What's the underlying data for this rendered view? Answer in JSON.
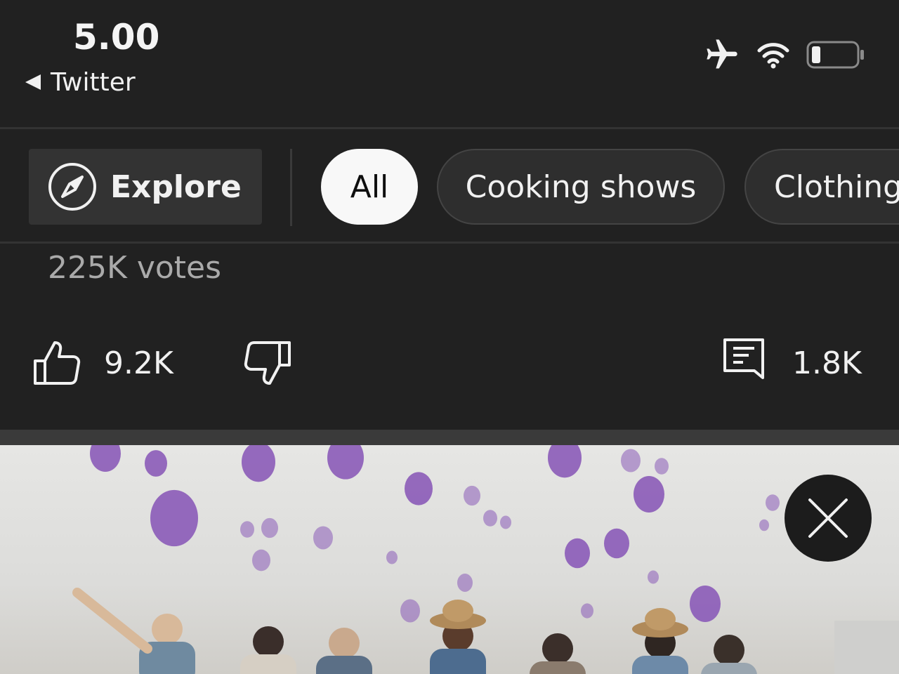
{
  "status_bar": {
    "time": "5.00",
    "back_label": "Twitter",
    "icons": [
      "airplane-mode-icon",
      "wifi-icon",
      "battery-icon"
    ]
  },
  "chips": {
    "explore_label": "Explore",
    "items": [
      {
        "label": "All",
        "selected": true
      },
      {
        "label": "Cooking shows",
        "selected": false
      },
      {
        "label": "Clothing",
        "selected": false
      }
    ]
  },
  "poll": {
    "votes": "225K votes"
  },
  "actions": {
    "likes": "9.2K",
    "comments": "1.8K"
  },
  "video": {
    "background_color": "#e2e2e0",
    "balloon_color": "#8b5bb8"
  }
}
